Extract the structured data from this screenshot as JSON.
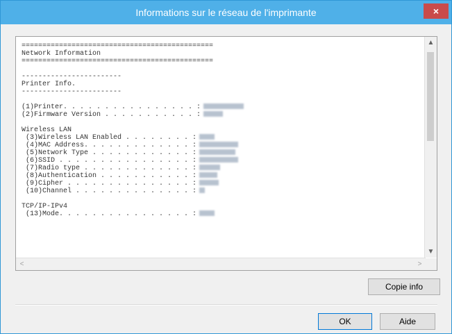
{
  "window": {
    "title": "Informations sur le réseau de l'imprimante",
    "close_glyph": "×"
  },
  "report": {
    "lines": [
      "==============================================",
      "Network Information",
      "==============================================",
      "",
      "------------------------",
      "Printer Info.",
      "------------------------",
      "",
      "(1)Printer. . . . . . . . . . . . . . . . :",
      "(2)Firmware Version . . . . . . . . . . . :",
      "",
      "Wireless LAN",
      " (3)Wireless LAN Enabled . . . . . . . . :",
      " (4)MAC Address. . . . . . . . . . . . . :",
      " (5)Network Type . . . . . . . . . . . . :",
      " (6)SSID . . . . . . . . . . . . . . . . :",
      " (7)Radio type . . . . . . . . . . . . . :",
      " (8)Authentication . . . . . . . . . . . :",
      " (9)Cipher . . . . . . . . . . . . . . . :",
      " (10)Channel . . . . . . . . . . . . . . :",
      "",
      "TCP/IP-IPv4",
      " (13)Mode. . . . . . . . . . . . . . . . :"
    ]
  },
  "buttons": {
    "copy_info": "Copie info",
    "ok": "OK",
    "help": "Aide"
  },
  "icons": {
    "scroll_up": "▲",
    "scroll_down": "▼",
    "scroll_left": "<",
    "scroll_right": ">"
  }
}
